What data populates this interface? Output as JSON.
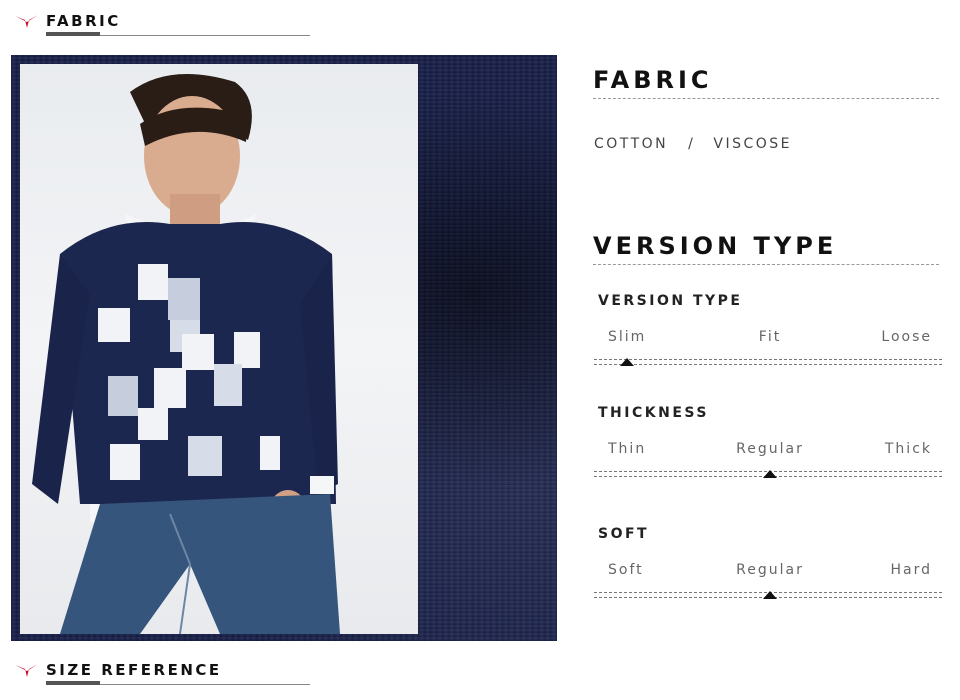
{
  "header": {
    "title": "FABRIC"
  },
  "footer_header": {
    "title": "SIZE REFERENCE"
  },
  "fabric": {
    "heading": "FABRIC",
    "materials": [
      "COTTON",
      "VISCOSE"
    ],
    "separator": "/"
  },
  "version": {
    "heading": "VERSION TYPE",
    "scales": [
      {
        "title": "VERSION TYPE",
        "labels": [
          "Slim",
          "Fit",
          "Loose"
        ],
        "selected_index": 0,
        "selected_value": "Slim"
      },
      {
        "title": "THICKNESS",
        "labels": [
          "Thin",
          "Regular",
          "Thick"
        ],
        "selected_index": 1,
        "selected_value": "Regular"
      },
      {
        "title": "SOFT",
        "labels": [
          "Soft",
          "Regular",
          "Hard"
        ],
        "selected_index": 1,
        "selected_value": "Regular"
      }
    ]
  },
  "colors": {
    "accent_red": "#c8102e",
    "sweater_navy": "#1c2750",
    "knit_background": "#1b2248"
  }
}
